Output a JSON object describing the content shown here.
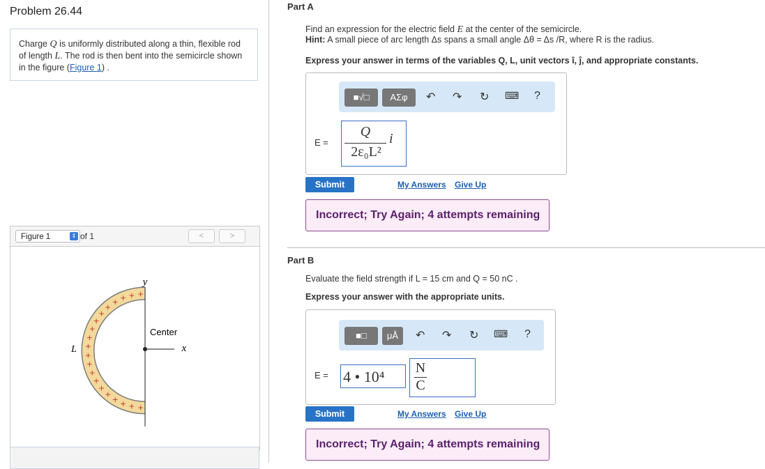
{
  "problem": {
    "title": "Problem 26.44",
    "description_parts": [
      "Charge ",
      "Q",
      " is uniformly distributed along a thin, flexible rod of length ",
      "L",
      ". The rod is then bent into the semicircle shown in the figure (",
      "Figure 1",
      ") ."
    ]
  },
  "figure_panel": {
    "select_value": "Figure 1",
    "of_label": "of 1",
    "prev": "<",
    "next": ">",
    "labels": {
      "y": "y",
      "x": "x",
      "center": "Center",
      "L": "L"
    }
  },
  "partA": {
    "label": "Part A",
    "line1_a": "Find an expression for the electric field ",
    "line1_sym": "E",
    "line1_b": " at the center of the semicircle.",
    "hint_label": "Hint:",
    "hint_text": " A small piece of arc length Δs spans a small angle Δθ = Δs /R, where R is the radius.",
    "instruction": "Express your answer in terms of the variables Q, L, unit vectors î, ĵ, and appropriate constants.",
    "toolbar": {
      "btn1": "■√□",
      "btn2": "ΑΣφ",
      "help": "?"
    },
    "eq_label": "E =",
    "answer": {
      "numerator": "Q",
      "denominator": "2ε₀L²",
      "unit_vector": "i"
    },
    "submit": "Submit",
    "my_answers": "My Answers",
    "give_up": "Give Up",
    "feedback": "Incorrect; Try Again; 4 attempts remaining"
  },
  "partB": {
    "label": "Part B",
    "line1": "Evaluate the field strength if L = 15 cm and Q = 50 nC .",
    "instruction": "Express your answer with the appropriate units.",
    "toolbar": {
      "btn1": "■□",
      "btn2": "μÅ",
      "help": "?"
    },
    "eq_label": "E =",
    "value": "4 • 10⁴",
    "unit_num": "N",
    "unit_den": "C",
    "submit": "Submit",
    "my_answers": "My Answers",
    "give_up": "Give Up",
    "feedback": "Incorrect; Try Again; 4 attempts remaining"
  },
  "colors": {
    "accent": "#2873c6",
    "toolbar_bg": "#d6e8f7",
    "feedback_border": "#8d4b91",
    "feedback_bg": "#fbecf8",
    "rod_fill": "#f3d99b"
  }
}
